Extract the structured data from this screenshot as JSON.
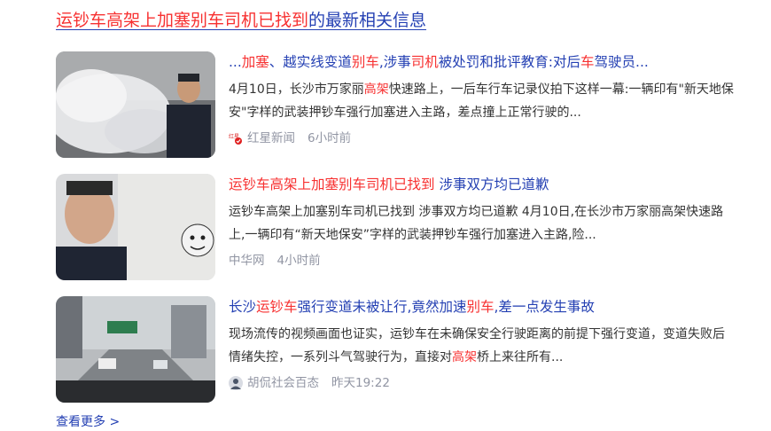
{
  "header": {
    "keyword": "运钞车高架上加塞别车司机已找到",
    "suffix": "的最新相关信息"
  },
  "items": [
    {
      "title_parts": [
        {
          "t": "...",
          "hl": false
        },
        {
          "t": "加塞",
          "hl": true
        },
        {
          "t": "、越实线变道",
          "hl": false
        },
        {
          "t": "别车",
          "hl": true
        },
        {
          "t": ",涉事",
          "hl": false
        },
        {
          "t": "司机",
          "hl": true
        },
        {
          "t": "被处罚和批评教育:对后",
          "hl": false
        },
        {
          "t": "车",
          "hl": true
        },
        {
          "t": "驾驶员...",
          "hl": false
        }
      ],
      "summary_parts": [
        {
          "t": "4月10日，长沙市万家丽",
          "hl": false
        },
        {
          "t": "高架",
          "hl": true
        },
        {
          "t": "快速路上，一后车行车记录仪拍下这样一幕:一辆印有\"新天地保安\"字样的武装押钞车强行加塞进入主路，差点撞上正常行驶的...",
          "hl": false
        }
      ],
      "source": "红星新闻",
      "source_icon": "hongxing-news-icon",
      "time": "6小时前"
    },
    {
      "title_parts": [
        {
          "t": "运钞车高架上加塞别车司机已找到",
          "hl": true
        },
        {
          "t": " 涉事双方均已道歉",
          "hl": false
        }
      ],
      "summary_parts": [
        {
          "t": "运钞车高架上加塞别车司机已找到 涉事双方均已道歉 4月10日,在长沙市万家丽高架快速路上,一辆印有“新天地保安”字样的武装押钞车强行加塞进入主路,险...",
          "hl": false
        }
      ],
      "source": "中华网",
      "time": "4小时前"
    },
    {
      "title_parts": [
        {
          "t": "长沙",
          "hl": false
        },
        {
          "t": "运钞车",
          "hl": true
        },
        {
          "t": "强行变道未被让行,竟然加速",
          "hl": false
        },
        {
          "t": "别车",
          "hl": true
        },
        {
          "t": ",差一点发生事故",
          "hl": false
        }
      ],
      "summary_parts": [
        {
          "t": "现场流传的视频画面也证实，运钞车在未确保安全行驶距离的前提下强行变道，变道失败后情绪失控，一系列斗气驾驶行为，直接对",
          "hl": false
        },
        {
          "t": "高架",
          "hl": true
        },
        {
          "t": "桥上来往所有...",
          "hl": false
        }
      ],
      "source": "胡侃社会百态",
      "source_icon": "avatar-icon",
      "time": "昨天19:22"
    }
  ],
  "more_link": "查看更多 >"
}
